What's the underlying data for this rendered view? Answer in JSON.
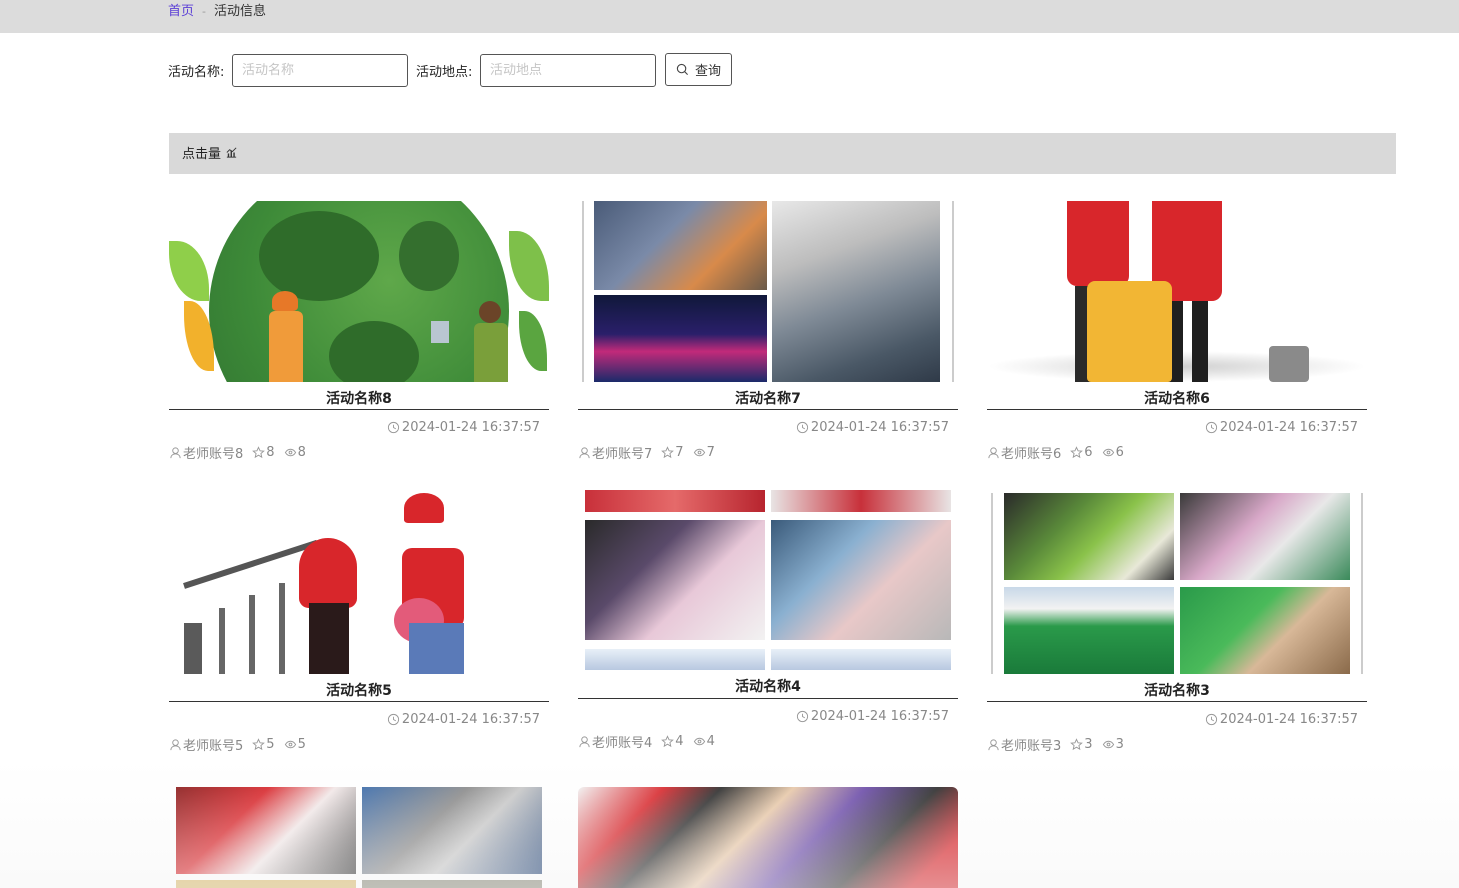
{
  "breadcrumb": {
    "home": "首页",
    "separator": "-",
    "current": "活动信息"
  },
  "search": {
    "name_label": "活动名称:",
    "name_placeholder": "活动名称",
    "name_value": "",
    "location_label": "活动地点:",
    "location_placeholder": "活动地点",
    "location_value": "",
    "button_label": "查询",
    "button_icon": "search-icon"
  },
  "sort": {
    "label": "点击量",
    "icon": "bar-chart-icon"
  },
  "colors": {
    "accent": "#5b3fd6",
    "bar": "#dcdcdc",
    "muted": "#888888"
  },
  "cards": [
    {
      "title": "活动名称8",
      "datetime": "2024-01-24 16:37:57",
      "account": "老师账号8",
      "stars": "8",
      "views": "8"
    },
    {
      "title": "活动名称7",
      "datetime": "2024-01-24 16:37:57",
      "account": "老师账号7",
      "stars": "7",
      "views": "7"
    },
    {
      "title": "活动名称6",
      "datetime": "2024-01-24 16:37:57",
      "account": "老师账号6",
      "stars": "6",
      "views": "6"
    },
    {
      "title": "活动名称5",
      "datetime": "2024-01-24 16:37:57",
      "account": "老师账号5",
      "stars": "5",
      "views": "5"
    },
    {
      "title": "活动名称4",
      "datetime": "2024-01-24 16:37:57",
      "account": "老师账号4",
      "stars": "4",
      "views": "4"
    },
    {
      "title": "活动名称3",
      "datetime": "2024-01-24 16:37:57",
      "account": "老师账号3",
      "stars": "3",
      "views": "3"
    }
  ]
}
